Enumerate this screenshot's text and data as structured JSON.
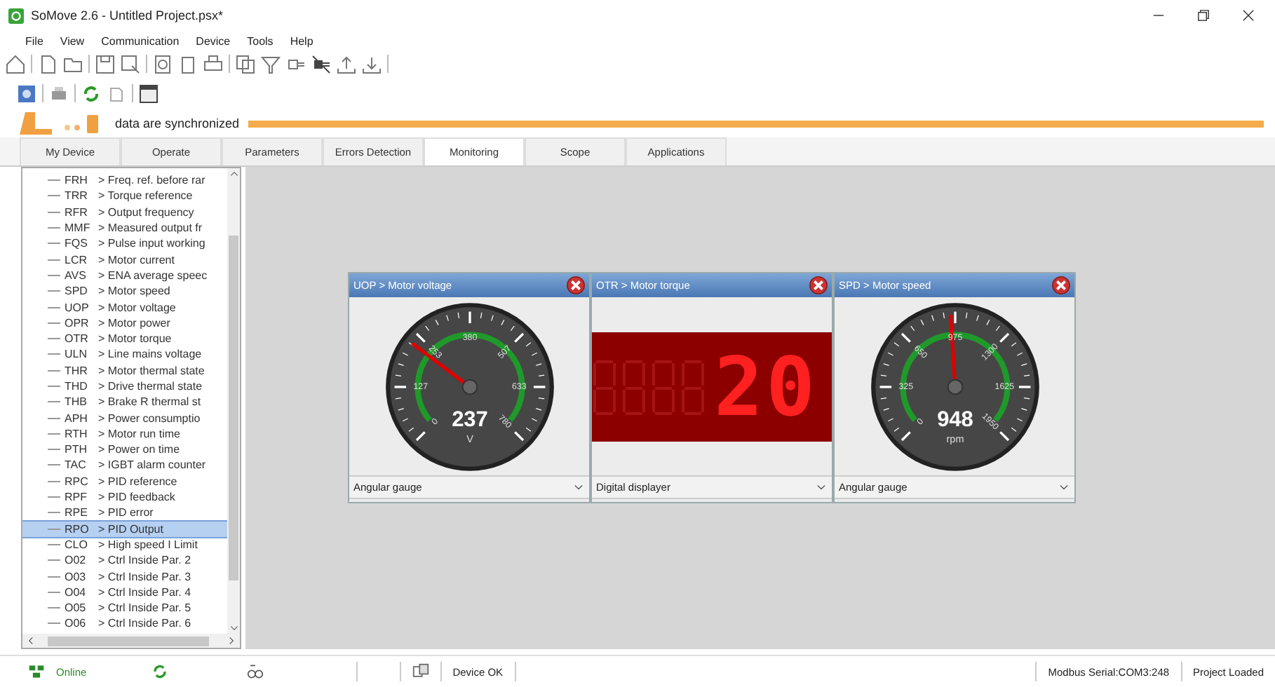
{
  "window": {
    "title": "SoMove 2.6 - Untitled Project.psx*"
  },
  "menu": [
    "File",
    "View",
    "Communication",
    "Device",
    "Tools",
    "Help"
  ],
  "sync": {
    "text": "data are synchronized",
    "level": 1
  },
  "tabs": [
    {
      "label": "My Device",
      "selected": false
    },
    {
      "label": "Operate",
      "selected": false
    },
    {
      "label": "Parameters",
      "selected": false
    },
    {
      "label": "Errors Detection",
      "selected": false
    },
    {
      "label": "Monitoring",
      "selected": true
    },
    {
      "label": "Scope",
      "selected": false
    },
    {
      "label": "Applications",
      "selected": false
    }
  ],
  "tree": {
    "items": [
      {
        "code": "FRH",
        "label": "> Freq. ref. before rar",
        "selected": false
      },
      {
        "code": "TRR",
        "label": "> Torque reference",
        "selected": false
      },
      {
        "code": "RFR",
        "label": "> Output frequency",
        "selected": false
      },
      {
        "code": "MMF",
        "label": "> Measured output fr",
        "selected": false
      },
      {
        "code": "FQS",
        "label": "> Pulse input working",
        "selected": false
      },
      {
        "code": "LCR",
        "label": "> Motor current",
        "selected": false
      },
      {
        "code": "AVS",
        "label": "> ENA average speec",
        "selected": false
      },
      {
        "code": "SPD",
        "label": "> Motor speed",
        "selected": false
      },
      {
        "code": "UOP",
        "label": "> Motor voltage",
        "selected": false
      },
      {
        "code": "OPR",
        "label": "> Motor power",
        "selected": false
      },
      {
        "code": "OTR",
        "label": "> Motor torque",
        "selected": false
      },
      {
        "code": "ULN",
        "label": "> Line mains voltage",
        "selected": false
      },
      {
        "code": "THR",
        "label": "> Motor thermal state",
        "selected": false
      },
      {
        "code": "THD",
        "label": "> Drive thermal state",
        "selected": false
      },
      {
        "code": "THB",
        "label": "> Brake R thermal st",
        "selected": false
      },
      {
        "code": "APH",
        "label": "> Power consumptio",
        "selected": false
      },
      {
        "code": "RTH",
        "label": "> Motor run time",
        "selected": false
      },
      {
        "code": "PTH",
        "label": "> Power on time",
        "selected": false
      },
      {
        "code": "TAC",
        "label": "> IGBT alarm counter",
        "selected": false
      },
      {
        "code": "RPC",
        "label": "> PID reference",
        "selected": false
      },
      {
        "code": "RPF",
        "label": "> PID feedback",
        "selected": false
      },
      {
        "code": "RPE",
        "label": "> PID error",
        "selected": false
      },
      {
        "code": "RPO",
        "label": "> PID Output",
        "selected": true
      },
      {
        "code": "CLO",
        "label": "> High speed I Limit",
        "selected": false
      },
      {
        "code": "O02",
        "label": "> Ctrl Inside Par. 2",
        "selected": false
      },
      {
        "code": "O03",
        "label": "> Ctrl Inside Par. 3",
        "selected": false
      },
      {
        "code": "O04",
        "label": "> Ctrl Inside Par. 4",
        "selected": false
      },
      {
        "code": "O05",
        "label": "> Ctrl Inside Par. 5",
        "selected": false
      },
      {
        "code": "O06",
        "label": "> Ctrl Inside Par. 6",
        "selected": false
      }
    ]
  },
  "monitors": [
    {
      "kind": "gauge",
      "title": "UOP > Motor voltage",
      "scale": [
        "0",
        "127",
        "253",
        "380",
        "507",
        "633",
        "780"
      ],
      "value": "237",
      "unit": "V",
      "display_type": "Angular gauge"
    },
    {
      "kind": "digital",
      "title": "OTR > Motor torque",
      "value": "20",
      "display_type": "Digital displayer"
    },
    {
      "kind": "gauge",
      "title": "SPD > Motor speed",
      "scale": [
        "0",
        "325",
        "650",
        "975",
        "1300",
        "1625",
        "1950"
      ],
      "value": "948",
      "unit": "rpm",
      "display_type": "Angular gauge"
    }
  ],
  "status_bar": {
    "online": "Online",
    "device": "Device OK",
    "connection": "Modbus Serial:COM3:248",
    "project": "Project Loaded"
  }
}
